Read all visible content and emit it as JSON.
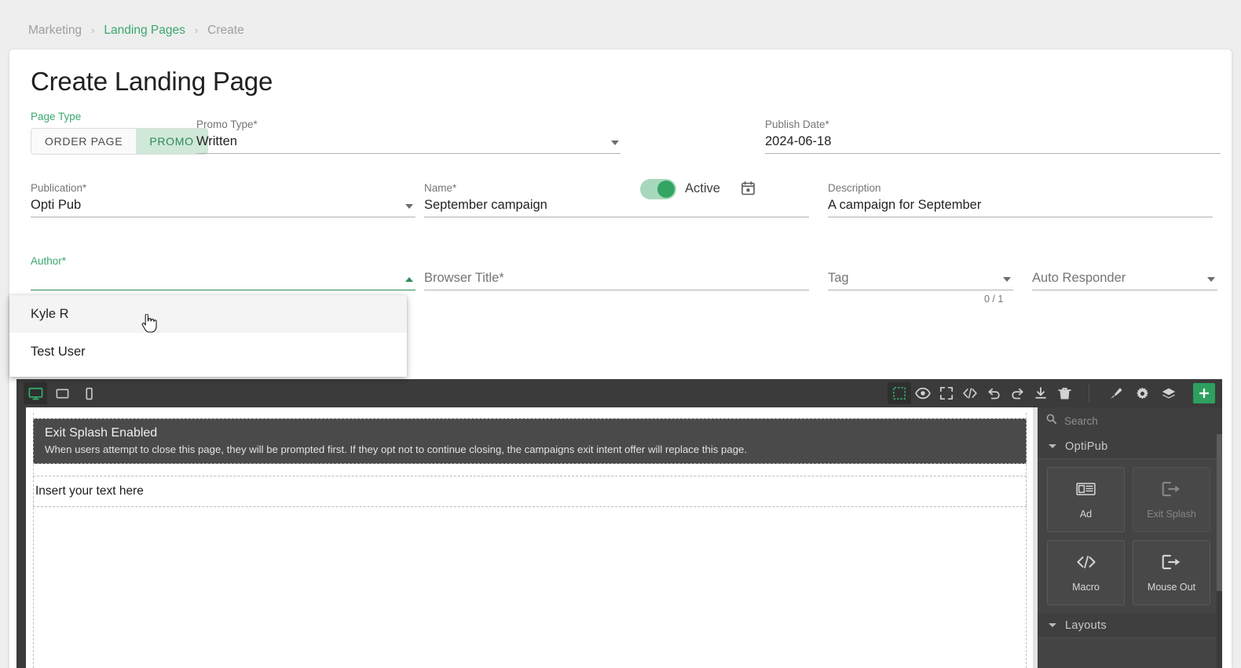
{
  "breadcrumb": {
    "items": [
      {
        "label": "Marketing",
        "active": false
      },
      {
        "label": "Landing Pages",
        "active": true
      },
      {
        "label": "Create",
        "active": false
      }
    ],
    "separator": "›"
  },
  "header": {
    "title": "Create Landing Page"
  },
  "form": {
    "page_type": {
      "label": "Page Type",
      "options": [
        "ORDER PAGE",
        "PROMO"
      ],
      "selected": "PROMO"
    },
    "promo_type": {
      "label": "Promo Type*",
      "value": "Written"
    },
    "active_toggle": {
      "label": "Active",
      "state": "on"
    },
    "publish_date": {
      "label": "Publish Date*",
      "value": "2024-06-18"
    },
    "publication": {
      "label": "Publication*",
      "value": "Opti Pub"
    },
    "name": {
      "label": "Name*",
      "value": "September campaign"
    },
    "description": {
      "label": "Description",
      "value": "A campaign for September"
    },
    "author": {
      "label": "Author*",
      "value": "",
      "focused": true,
      "options": [
        {
          "label": "Kyle R",
          "hovered": true
        },
        {
          "label": "Test User",
          "hovered": false
        }
      ]
    },
    "browser_title": {
      "label": "Browser Title*",
      "value": ""
    },
    "tag": {
      "label": "Tag",
      "value": "",
      "counter": "0 / 1"
    },
    "auto_responder": {
      "label": "Auto Responder",
      "value": ""
    }
  },
  "editor": {
    "devices": [
      {
        "name": "desktop",
        "active": true
      },
      {
        "name": "tablet",
        "active": false
      },
      {
        "name": "mobile",
        "active": false
      }
    ],
    "tools": [
      {
        "name": "borders",
        "active": true
      },
      {
        "name": "preview",
        "active": false
      },
      {
        "name": "fullscreen",
        "active": false
      },
      {
        "name": "code",
        "active": false
      },
      {
        "name": "undo",
        "active": false
      },
      {
        "name": "redo",
        "active": false
      },
      {
        "name": "import",
        "active": false
      },
      {
        "name": "delete",
        "active": false
      },
      {
        "name": "paint",
        "active": false
      },
      {
        "name": "settings",
        "active": false
      },
      {
        "name": "layers",
        "active": false
      },
      {
        "name": "add-blocks",
        "active": false
      }
    ],
    "canvas": {
      "splash": {
        "title": "Exit Splash Enabled",
        "subtitle": "When users attempt to close this page, they will be prompted first. If they opt not to continue closing, the campaigns exit intent offer will replace this page."
      },
      "text_block": "Insert your text here"
    },
    "block_panel": {
      "search_placeholder": "Search",
      "sections": [
        {
          "label": "OptiPub",
          "expanded": true,
          "blocks": [
            {
              "label": "Ad",
              "icon": "ad-icon",
              "disabled": false
            },
            {
              "label": "Exit Splash",
              "icon": "exit-splash-icon",
              "disabled": true
            },
            {
              "label": "Macro",
              "icon": "macro-icon",
              "disabled": false
            },
            {
              "label": "Mouse Out",
              "icon": "mouse-out-icon",
              "disabled": false
            }
          ]
        },
        {
          "label": "Layouts",
          "expanded": true,
          "blocks": []
        }
      ]
    }
  },
  "colors": {
    "accent_green": "#3aa76d",
    "toggle_green": "#33a463",
    "seg_active_bg": "#cfe8d8",
    "toolbar_bg": "#3b3b3b",
    "panel_bg": "#444444",
    "page_bg": "#eeeeee"
  }
}
